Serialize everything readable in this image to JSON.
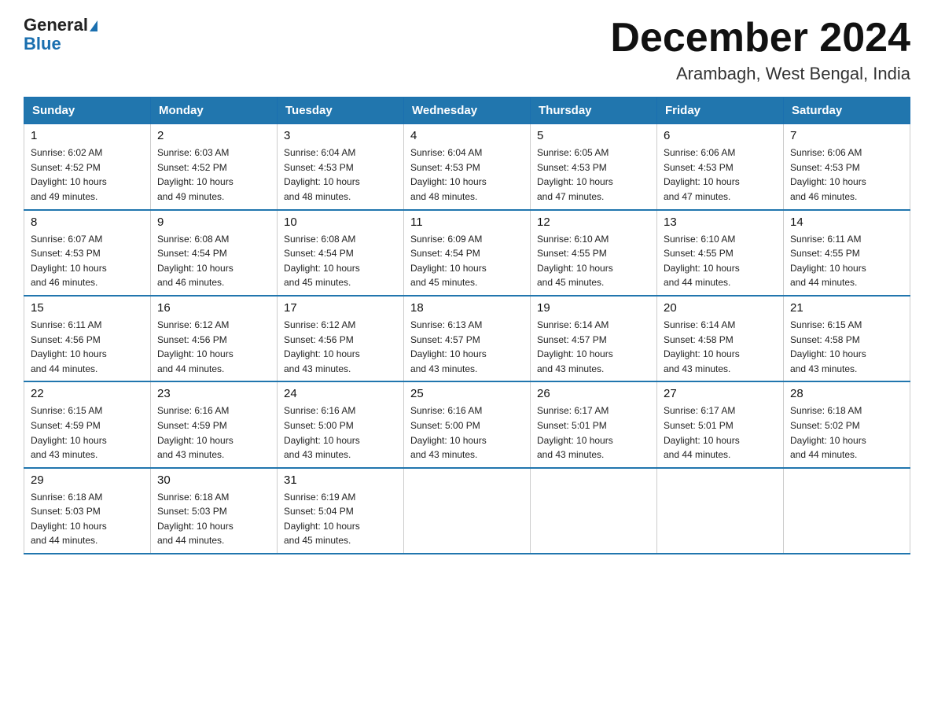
{
  "header": {
    "logo_line1": "General",
    "logo_line2": "Blue",
    "month": "December 2024",
    "location": "Arambagh, West Bengal, India"
  },
  "weekdays": [
    "Sunday",
    "Monday",
    "Tuesday",
    "Wednesday",
    "Thursday",
    "Friday",
    "Saturday"
  ],
  "weeks": [
    [
      {
        "day": "1",
        "sunrise": "6:02 AM",
        "sunset": "4:52 PM",
        "daylight": "10 hours and 49 minutes."
      },
      {
        "day": "2",
        "sunrise": "6:03 AM",
        "sunset": "4:52 PM",
        "daylight": "10 hours and 49 minutes."
      },
      {
        "day": "3",
        "sunrise": "6:04 AM",
        "sunset": "4:53 PM",
        "daylight": "10 hours and 48 minutes."
      },
      {
        "day": "4",
        "sunrise": "6:04 AM",
        "sunset": "4:53 PM",
        "daylight": "10 hours and 48 minutes."
      },
      {
        "day": "5",
        "sunrise": "6:05 AM",
        "sunset": "4:53 PM",
        "daylight": "10 hours and 47 minutes."
      },
      {
        "day": "6",
        "sunrise": "6:06 AM",
        "sunset": "4:53 PM",
        "daylight": "10 hours and 47 minutes."
      },
      {
        "day": "7",
        "sunrise": "6:06 AM",
        "sunset": "4:53 PM",
        "daylight": "10 hours and 46 minutes."
      }
    ],
    [
      {
        "day": "8",
        "sunrise": "6:07 AM",
        "sunset": "4:53 PM",
        "daylight": "10 hours and 46 minutes."
      },
      {
        "day": "9",
        "sunrise": "6:08 AM",
        "sunset": "4:54 PM",
        "daylight": "10 hours and 46 minutes."
      },
      {
        "day": "10",
        "sunrise": "6:08 AM",
        "sunset": "4:54 PM",
        "daylight": "10 hours and 45 minutes."
      },
      {
        "day": "11",
        "sunrise": "6:09 AM",
        "sunset": "4:54 PM",
        "daylight": "10 hours and 45 minutes."
      },
      {
        "day": "12",
        "sunrise": "6:10 AM",
        "sunset": "4:55 PM",
        "daylight": "10 hours and 45 minutes."
      },
      {
        "day": "13",
        "sunrise": "6:10 AM",
        "sunset": "4:55 PM",
        "daylight": "10 hours and 44 minutes."
      },
      {
        "day": "14",
        "sunrise": "6:11 AM",
        "sunset": "4:55 PM",
        "daylight": "10 hours and 44 minutes."
      }
    ],
    [
      {
        "day": "15",
        "sunrise": "6:11 AM",
        "sunset": "4:56 PM",
        "daylight": "10 hours and 44 minutes."
      },
      {
        "day": "16",
        "sunrise": "6:12 AM",
        "sunset": "4:56 PM",
        "daylight": "10 hours and 44 minutes."
      },
      {
        "day": "17",
        "sunrise": "6:12 AM",
        "sunset": "4:56 PM",
        "daylight": "10 hours and 43 minutes."
      },
      {
        "day": "18",
        "sunrise": "6:13 AM",
        "sunset": "4:57 PM",
        "daylight": "10 hours and 43 minutes."
      },
      {
        "day": "19",
        "sunrise": "6:14 AM",
        "sunset": "4:57 PM",
        "daylight": "10 hours and 43 minutes."
      },
      {
        "day": "20",
        "sunrise": "6:14 AM",
        "sunset": "4:58 PM",
        "daylight": "10 hours and 43 minutes."
      },
      {
        "day": "21",
        "sunrise": "6:15 AM",
        "sunset": "4:58 PM",
        "daylight": "10 hours and 43 minutes."
      }
    ],
    [
      {
        "day": "22",
        "sunrise": "6:15 AM",
        "sunset": "4:59 PM",
        "daylight": "10 hours and 43 minutes."
      },
      {
        "day": "23",
        "sunrise": "6:16 AM",
        "sunset": "4:59 PM",
        "daylight": "10 hours and 43 minutes."
      },
      {
        "day": "24",
        "sunrise": "6:16 AM",
        "sunset": "5:00 PM",
        "daylight": "10 hours and 43 minutes."
      },
      {
        "day": "25",
        "sunrise": "6:16 AM",
        "sunset": "5:00 PM",
        "daylight": "10 hours and 43 minutes."
      },
      {
        "day": "26",
        "sunrise": "6:17 AM",
        "sunset": "5:01 PM",
        "daylight": "10 hours and 43 minutes."
      },
      {
        "day": "27",
        "sunrise": "6:17 AM",
        "sunset": "5:01 PM",
        "daylight": "10 hours and 44 minutes."
      },
      {
        "day": "28",
        "sunrise": "6:18 AM",
        "sunset": "5:02 PM",
        "daylight": "10 hours and 44 minutes."
      }
    ],
    [
      {
        "day": "29",
        "sunrise": "6:18 AM",
        "sunset": "5:03 PM",
        "daylight": "10 hours and 44 minutes."
      },
      {
        "day": "30",
        "sunrise": "6:18 AM",
        "sunset": "5:03 PM",
        "daylight": "10 hours and 44 minutes."
      },
      {
        "day": "31",
        "sunrise": "6:19 AM",
        "sunset": "5:04 PM",
        "daylight": "10 hours and 45 minutes."
      },
      null,
      null,
      null,
      null
    ]
  ],
  "labels": {
    "sunrise": "Sunrise:",
    "sunset": "Sunset:",
    "daylight": "Daylight:"
  }
}
